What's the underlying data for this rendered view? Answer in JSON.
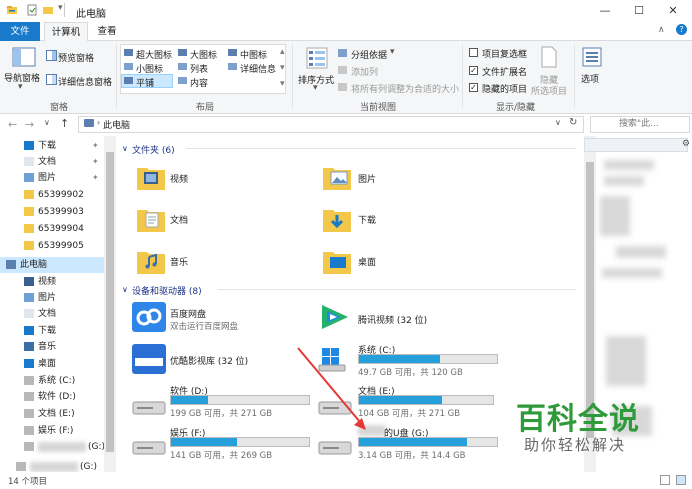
{
  "window": {
    "title": "此电脑",
    "controls": {
      "minimize": "—",
      "maximize": "☐",
      "close": "✕"
    }
  },
  "ribbon_tabs": [
    "文件",
    "计算机",
    "查看"
  ],
  "ribbon": {
    "panes": {
      "nav_pane_label": "导航窗格",
      "preview_pane": "预览窗格",
      "details_pane": "详细信息窗格",
      "group_label": "窗格"
    },
    "layout": {
      "items": [
        "超大图标",
        "大图标",
        "中图标",
        "小图标",
        "列表",
        "详细信息",
        "平铺",
        "内容"
      ],
      "selected": "平铺",
      "group_label": "布局"
    },
    "current_view": {
      "sort_label": "排序方式",
      "group_by": "分组依据",
      "add_column": "添加列",
      "fit_columns": "将所有列调整为合适的大小",
      "group_label": "当前视图"
    },
    "show_hide": {
      "item_checkboxes": "项目复选框",
      "file_extensions": "文件扩展名",
      "hidden_items": "隐藏的项目",
      "hide_selected_line1": "隐藏",
      "hide_selected_line2": "所选项目",
      "options": "选项",
      "group_label": "显示/隐藏"
    }
  },
  "address": {
    "path": "此电脑",
    "search_placeholder": "搜索\"此..."
  },
  "nav": {
    "items": [
      {
        "label": "下载",
        "icon": "download-arrow-icon",
        "pinned": true
      },
      {
        "label": "文档",
        "icon": "document-icon",
        "pinned": true
      },
      {
        "label": "图片",
        "icon": "pictures-icon",
        "pinned": true
      },
      {
        "label": "65399902",
        "icon": "folder-icon"
      },
      {
        "label": "65399903",
        "icon": "folder-icon"
      },
      {
        "label": "65399904",
        "icon": "folder-icon"
      },
      {
        "label": "65399905",
        "icon": "folder-icon"
      },
      {
        "label": "此电脑",
        "icon": "computer-icon",
        "selected": true
      },
      {
        "label": "视频",
        "icon": "video-folder-icon"
      },
      {
        "label": "图片",
        "icon": "pictures-icon"
      },
      {
        "label": "文档",
        "icon": "document-icon"
      },
      {
        "label": "下载",
        "icon": "download-arrow-icon"
      },
      {
        "label": "音乐",
        "icon": "music-icon"
      },
      {
        "label": "桌面",
        "icon": "desktop-icon"
      },
      {
        "label": "系统 (C:)",
        "icon": "drive-icon"
      },
      {
        "label": "软件 (D:)",
        "icon": "drive-icon"
      },
      {
        "label": "文档 (E:)",
        "icon": "drive-icon"
      },
      {
        "label": "娱乐 (F:)",
        "icon": "drive-icon"
      },
      {
        "label": "(G:)",
        "icon": "drive-icon"
      },
      {
        "label": "(G:)",
        "icon": "drive-icon"
      }
    ]
  },
  "content": {
    "folders_header": "文件夹 (6)",
    "folders": [
      "视频",
      "图片",
      "文档",
      "下载",
      "音乐",
      "桌面"
    ],
    "devices_header": "设备和驱动器 (8)",
    "apps": [
      {
        "name": "百度网盘",
        "sub": "双击运行百度网盘"
      },
      {
        "name": "腾讯视频 (32 位)",
        "sub": ""
      },
      {
        "name": "优酷影视库 (32 位)",
        "sub": ""
      }
    ],
    "drives": [
      {
        "name": "系统 (C:)",
        "free": "49.7 GB 可用，共 120 GB",
        "used_fraction": 0.59
      },
      {
        "name": "软件 (D:)",
        "free": "199 GB 可用，共 271 GB",
        "used_fraction": 0.27
      },
      {
        "name": "文档 (E:)",
        "free": "104 GB 可用，共 271 GB",
        "used_fraction": 0.62
      },
      {
        "name": "娱乐 (F:)",
        "free": "141 GB 可用，共 269 GB",
        "used_fraction": 0.48
      },
      {
        "name": "的U盘 (G:)",
        "free": "3.14 GB 可用，共 14.4 GB",
        "used_fraction": 0.78
      }
    ]
  },
  "status": {
    "count": "14 个项目"
  },
  "watermark": {
    "title": "百科全说",
    "subtitle": "助你轻松解决"
  },
  "colors": {
    "accent": "#1979ca",
    "bar_fill": "#26a0da",
    "folder": "#f3c74a",
    "watermark": "#2f9a3a"
  }
}
